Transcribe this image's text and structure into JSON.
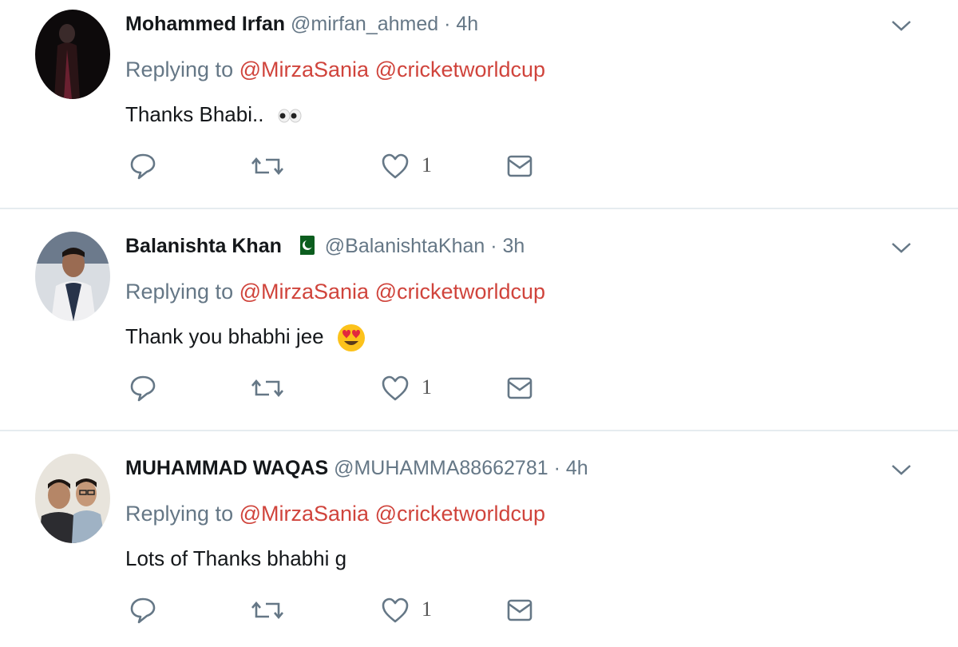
{
  "tweets": [
    {
      "name": "Mohammed Irfan",
      "handle": "@mirfan_ahmed",
      "separator": "·",
      "time": "4h",
      "replying_prefix": "Replying to",
      "mentions": [
        "@MirzaSania",
        "@cricketworldcup"
      ],
      "text": "Thanks Bhabi..",
      "emoji": "eyes",
      "like_count": "1"
    },
    {
      "name": "Balanishta Khan",
      "flag_icon": "pakistan-flag-icon",
      "handle": "@BalanishtaKhan",
      "separator": "·",
      "time": "3h",
      "replying_prefix": "Replying to",
      "mentions": [
        "@MirzaSania",
        "@cricketworldcup"
      ],
      "text": "Thank you bhabhi jee",
      "emoji": "heart-eyes",
      "like_count": "1"
    },
    {
      "name": "MUHAMMAD WAQAS",
      "handle": "@MUHAMMA88662781",
      "separator": "·",
      "time": "4h",
      "replying_prefix": "Replying to",
      "mentions": [
        "@MirzaSania",
        "@cricketworldcup"
      ],
      "text": "Lots of Thanks bhabhi g",
      "like_count": "1"
    }
  ],
  "colors": {
    "mention": "#d0443c",
    "secondary_text": "#657786",
    "divider": "#e6ecf0",
    "icon": "#657786"
  }
}
